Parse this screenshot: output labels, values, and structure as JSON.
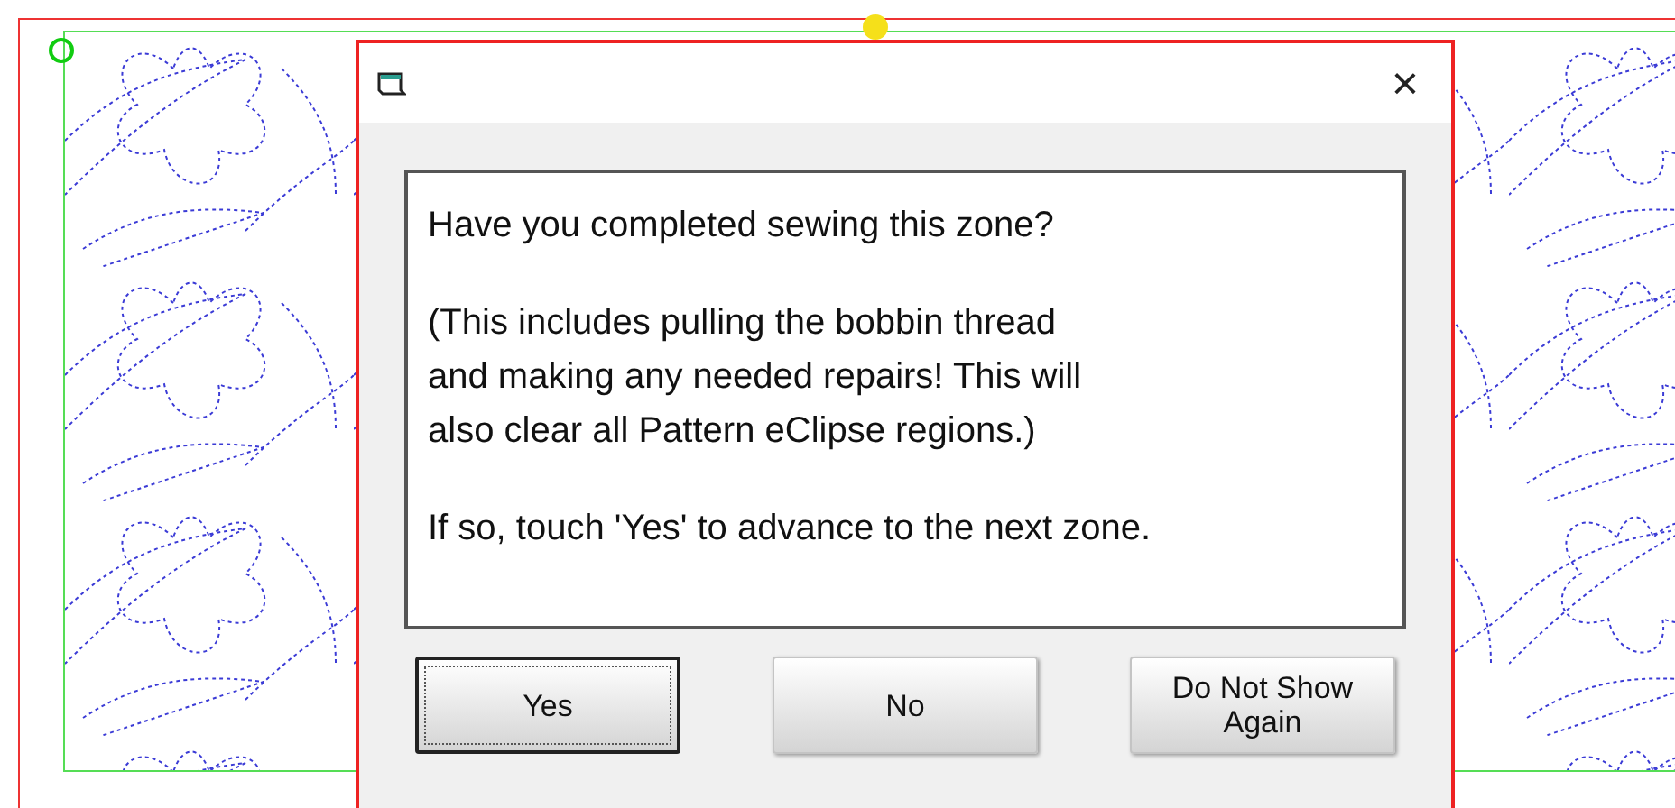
{
  "dialog": {
    "close_glyph": "×",
    "message": [
      {
        "lines": [
          "Have you completed sewing this zone?"
        ]
      },
      {
        "lines": [
          "(This includes pulling the bobbin thread",
          "and making any needed repairs! This will",
          "also clear all Pattern eClipse regions.)"
        ]
      },
      {
        "lines": [
          "If so, touch 'Yes' to advance to the next zone."
        ]
      }
    ],
    "buttons": [
      {
        "label": "Yes",
        "focused": true
      },
      {
        "label": "No",
        "focused": false
      },
      {
        "label": "Do Not Show Again",
        "focused": false
      }
    ]
  }
}
